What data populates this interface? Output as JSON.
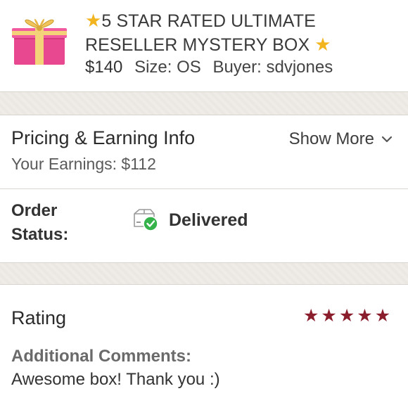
{
  "listing": {
    "title_prefix_icon": "star-icon",
    "title": "5 STAR RATED ULTIMATE RESELLER MYSTERY BOX",
    "title_suffix_icon": "star-icon",
    "price": "$140",
    "size": "Size: OS",
    "buyer": "Buyer: sdvjones",
    "thumbnail_icon": "gift-box-icon"
  },
  "pricing": {
    "heading": "Pricing & Earning Info",
    "earnings": "Your Earnings: $112",
    "show_more_label": "Show More",
    "show_more_icon": "chevron-down-icon"
  },
  "order": {
    "label": "Order Status:",
    "status_icon": "delivered-box-check-icon",
    "status": "Delivered"
  },
  "rating": {
    "heading": "Rating",
    "stars": 5,
    "max_stars": 5,
    "star_color": "#8a1e2c",
    "comments_label": "Additional Comments:",
    "comments": "Awesome box! Thank you :)"
  },
  "colors": {
    "band": "#efebe6",
    "accent_star": "#f2b51f",
    "check_green": "#35b34a"
  }
}
